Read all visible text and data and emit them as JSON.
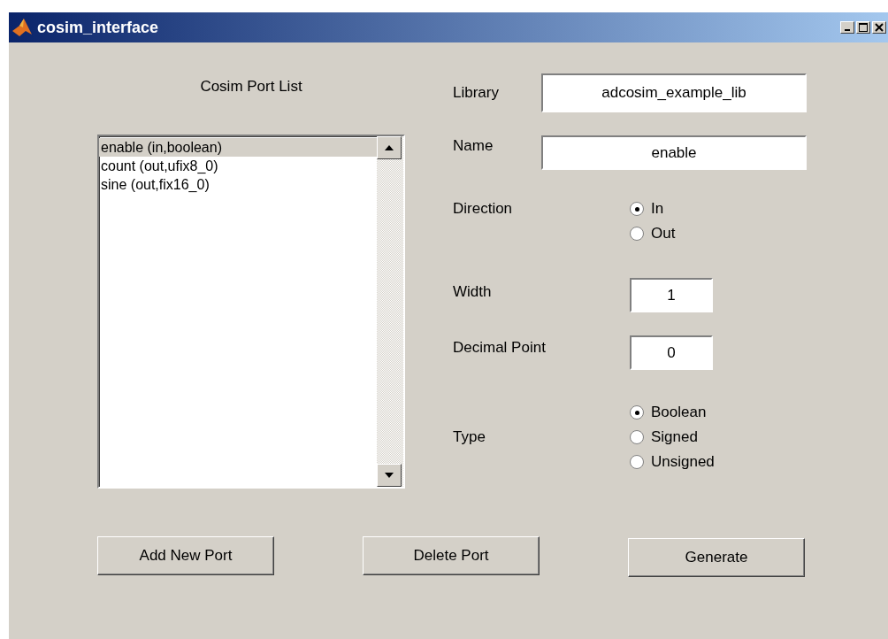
{
  "window": {
    "title": "cosim_interface"
  },
  "port_list": {
    "title": "Cosim Port List",
    "items": [
      {
        "label": "enable (in,boolean)",
        "selected": true
      },
      {
        "label": "count (out,ufix8_0)",
        "selected": false
      },
      {
        "label": "sine (out,fix16_0)",
        "selected": false
      }
    ]
  },
  "library": {
    "label": "Library",
    "value": "adcosim_example_lib"
  },
  "name": {
    "label": "Name",
    "value": "enable"
  },
  "direction": {
    "label": "Direction",
    "options": [
      {
        "label": "In",
        "selected": true
      },
      {
        "label": "Out",
        "selected": false
      }
    ]
  },
  "width": {
    "label": "Width",
    "value": "1"
  },
  "decimal_point": {
    "label": "Decimal Point",
    "value": "0"
  },
  "type": {
    "label": "Type",
    "options": [
      {
        "label": "Boolean",
        "selected": true
      },
      {
        "label": "Signed",
        "selected": false
      },
      {
        "label": "Unsigned",
        "selected": false
      }
    ]
  },
  "buttons": [
    "Add New Port",
    "Delete Port",
    "Generate"
  ]
}
